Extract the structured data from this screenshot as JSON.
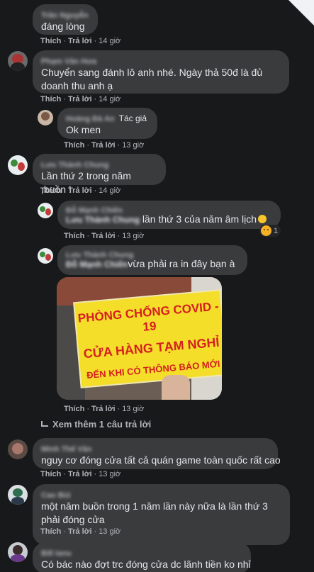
{
  "colors": {
    "background": "#18191a",
    "bubble": "#3a3b3c",
    "text": "#e4e6eb",
    "muted": "#b0b3b8",
    "sign_yellow": "#f4de2a",
    "sign_red": "#d61f1f"
  },
  "actions": {
    "like": "Thích",
    "reply": "Trả lời",
    "dot": "·"
  },
  "comments": [
    {
      "name": "Trần Nguyễn",
      "text": "đáng lòng",
      "time": "14 giờ"
    },
    {
      "name": "Phạm Văn Hưa",
      "text": "Chuyển sang đánh lô anh nhé. Ngày thả 50đ là đủ doanh thu anh ạ",
      "time": "14 giờ"
    },
    {
      "name": "Hoàng Đà An",
      "author_badge": "Tác giả",
      "text": "Ok men",
      "time": "13 giờ"
    },
    {
      "name": "Lưu Thành Chung",
      "text": "Lần thứ 2 trong năm ,buồn !",
      "time": "14 giờ"
    },
    {
      "name": "Đỗ Mạnh Chiến",
      "mention": "Lưu Thành Chung",
      "text": "lần thứ 3 của năm âm lịch",
      "time": "13 giờ",
      "reaction_icon": "sad-emoji-icon",
      "reaction_count": "1"
    },
    {
      "name": "Lưu Thành Chung",
      "mention": "Đỗ Mạnh Chiến",
      "text": "vừa phải ra in đây bạn à",
      "time": "13 giờ",
      "image": {
        "lines": [
          "PHÒNG CHỐNG COVID - 19",
          "CỬA HÀNG TẠM NGHỈ",
          "ĐẾN KHI CÓ THÔNG BÁO MỚI"
        ]
      }
    },
    {
      "name": "Minh Thế Văn",
      "text": "nguy cơ đóng cửa tất cả quán game toàn quốc rất cao",
      "time": "13 giờ"
    },
    {
      "name": "Cao Bùi",
      "text": "một năm buồn trong 1 năm lần này nữa là lần thứ 3 phải đóng cửa",
      "time": "13 giờ"
    },
    {
      "name": "Bill Ianu",
      "text": "Có bác nào đợt trc đóng cửa dc lãnh tiền ko nhỉ"
    }
  ],
  "view_more": "Xem thêm 1 câu trả lời"
}
